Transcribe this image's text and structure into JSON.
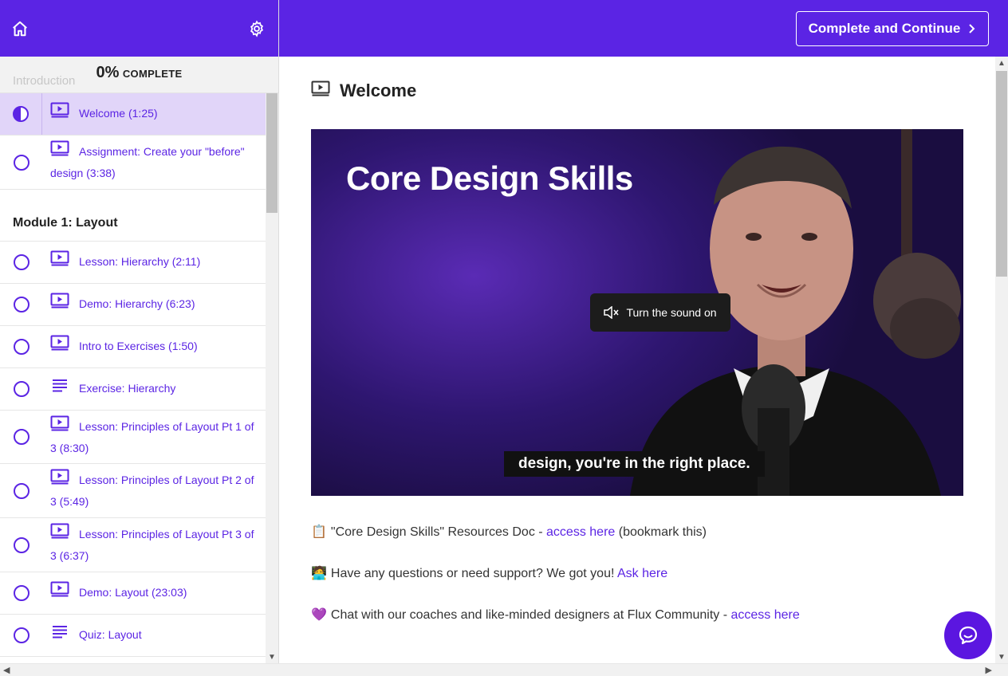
{
  "sidebar": {
    "home_icon": "home-icon",
    "settings_icon": "gear-icon",
    "progress": {
      "percent": "0%",
      "label": "COMPLETE",
      "section_behind": "Introduction"
    },
    "intro_items": [
      {
        "label": "Welcome (1:25)",
        "type": "video",
        "status": "in-progress",
        "active": true
      },
      {
        "label": "Assignment: Create your \"before\" design (3:38)",
        "type": "video",
        "status": "incomplete",
        "active": false
      }
    ],
    "module1": {
      "title": "Module 1: Layout",
      "items": [
        {
          "label": "Lesson: Hierarchy (2:11)",
          "type": "video"
        },
        {
          "label": "Demo: Hierarchy (6:23)",
          "type": "video"
        },
        {
          "label": "Intro to Exercises (1:50)",
          "type": "video"
        },
        {
          "label": "Exercise: Hierarchy",
          "type": "text"
        },
        {
          "label": "Lesson: Principles of Layout Pt 1 of 3 (8:30)",
          "type": "video"
        },
        {
          "label": "Lesson: Principles of Layout Pt 2 of 3 (5:49)",
          "type": "video"
        },
        {
          "label": "Lesson: Principles of Layout Pt 3 of 3 (6:37)",
          "type": "video"
        },
        {
          "label": "Demo: Layout (23:03)",
          "type": "video"
        },
        {
          "label": "Quiz: Layout",
          "type": "text"
        }
      ]
    }
  },
  "topbar": {
    "complete_button": "Complete and Continue"
  },
  "lecture": {
    "title": "Welcome",
    "video": {
      "overlay_title": "Core Design Skills",
      "sound_button": "Turn the sound on",
      "caption": "design, you're in the right place."
    },
    "resources": [
      {
        "emoji": "📋",
        "text": "\"Core Design Skills\" Resources Doc - ",
        "link": "access here",
        "suffix": " (bookmark this)"
      },
      {
        "emoji": "🧑‍💻",
        "text": "Have any questions or need support? We got you! ",
        "link": "Ask here",
        "suffix": ""
      },
      {
        "emoji": "💜",
        "text": "Chat with our coaches and like-minded designers at Flux Community - ",
        "link": "access here",
        "suffix": ""
      }
    ]
  },
  "colors": {
    "brand": "#5b24e4",
    "active_row": "#e1d5f9",
    "chat": "#5b16e0"
  }
}
